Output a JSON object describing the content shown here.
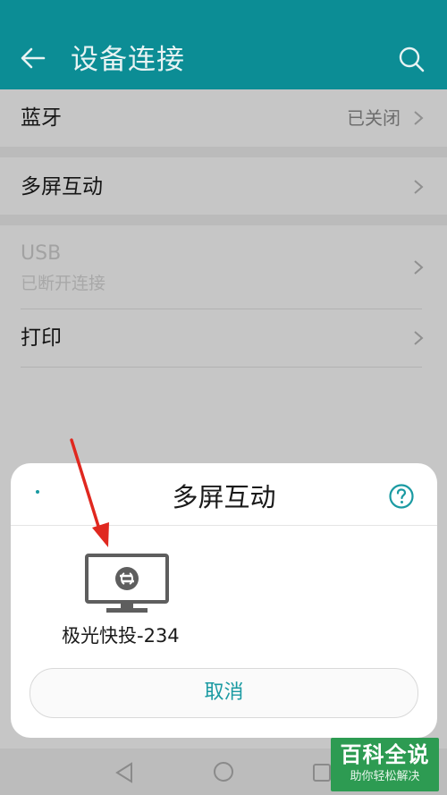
{
  "header": {
    "title": "设备连接",
    "background": "#0c8d95",
    "back_icon": "arrow-left",
    "search_icon": "magnifier"
  },
  "settings": {
    "bluetooth": {
      "label": "蓝牙",
      "value": "已关闭"
    },
    "multiscreen": {
      "label": "多屏互动"
    },
    "usb": {
      "label": "USB",
      "status": "已断开连接"
    },
    "print": {
      "label": "打印"
    }
  },
  "dialog": {
    "title": "多屏互动",
    "help_icon": "question-circle",
    "device": {
      "name": "极光快投-234",
      "icon": "tv-monitor"
    },
    "cancel_label": "取消",
    "accent": "#1a9aa2"
  },
  "annotation": {
    "arrow_color": "#e0281f"
  },
  "watermark": {
    "title": "百科全说",
    "subtitle": "助你轻松解决",
    "color": "#2d9b52"
  }
}
